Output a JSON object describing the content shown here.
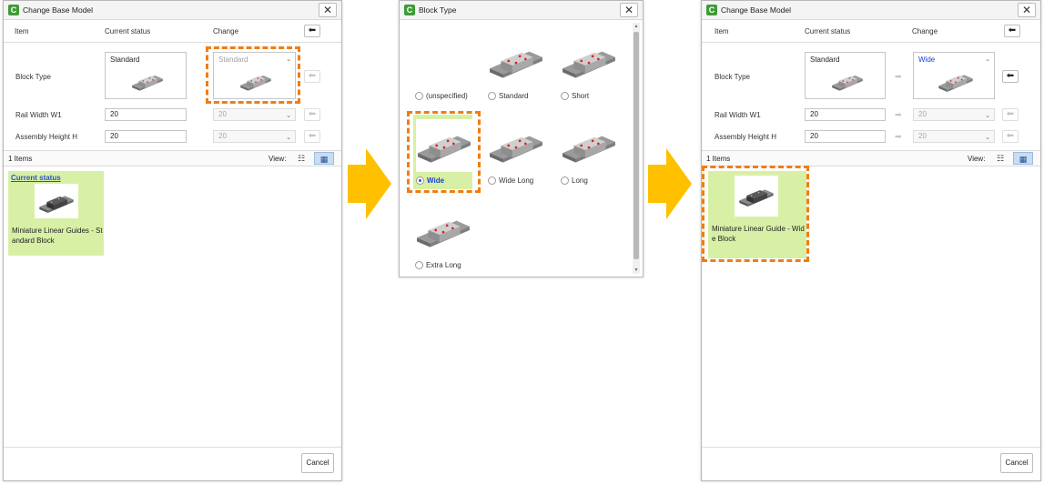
{
  "colors": {
    "highlight": "#f07d12",
    "card_bg": "#d8f0a6",
    "arrow": "#ffc000",
    "link": "#2a52c6"
  },
  "left": {
    "title": "Change Base Model",
    "header": {
      "item": "Item",
      "current": "Current status",
      "change": "Change"
    },
    "block_type": {
      "label": "Block Type",
      "current": "Standard",
      "change": "Standard"
    },
    "rail": {
      "label": "Rail Width W1",
      "current": "20",
      "change": "20"
    },
    "assembly": {
      "label": "Assembly Height H",
      "current": "20",
      "change": "20"
    },
    "items_count": "1 Items",
    "view_label": "View:",
    "result": {
      "link": "Current status",
      "name_line1": "Miniature Linear Guides - St",
      "name_line2": "andard Block"
    },
    "cancel": "Cancel"
  },
  "middle": {
    "title": "Block Type",
    "options": [
      {
        "label": "(unspecified)"
      },
      {
        "label": "Standard"
      },
      {
        "label": "Short"
      },
      {
        "label": "Wide"
      },
      {
        "label": "Wide Long"
      },
      {
        "label": "Long"
      },
      {
        "label": "Extra Long"
      }
    ]
  },
  "right": {
    "title": "Change Base Model",
    "header": {
      "item": "Item",
      "current": "Current status",
      "change": "Change"
    },
    "block_type": {
      "label": "Block Type",
      "current": "Standard",
      "change": "Wide"
    },
    "rail": {
      "label": "Rail Width W1",
      "current": "20",
      "change": "20"
    },
    "assembly": {
      "label": "Assembly Height H",
      "current": "20",
      "change": "20"
    },
    "items_count": "1 Items",
    "view_label": "View:",
    "result": {
      "name_line1": "Miniature Linear Guide - Wid",
      "name_line2": "e Block"
    },
    "cancel": "Cancel"
  }
}
